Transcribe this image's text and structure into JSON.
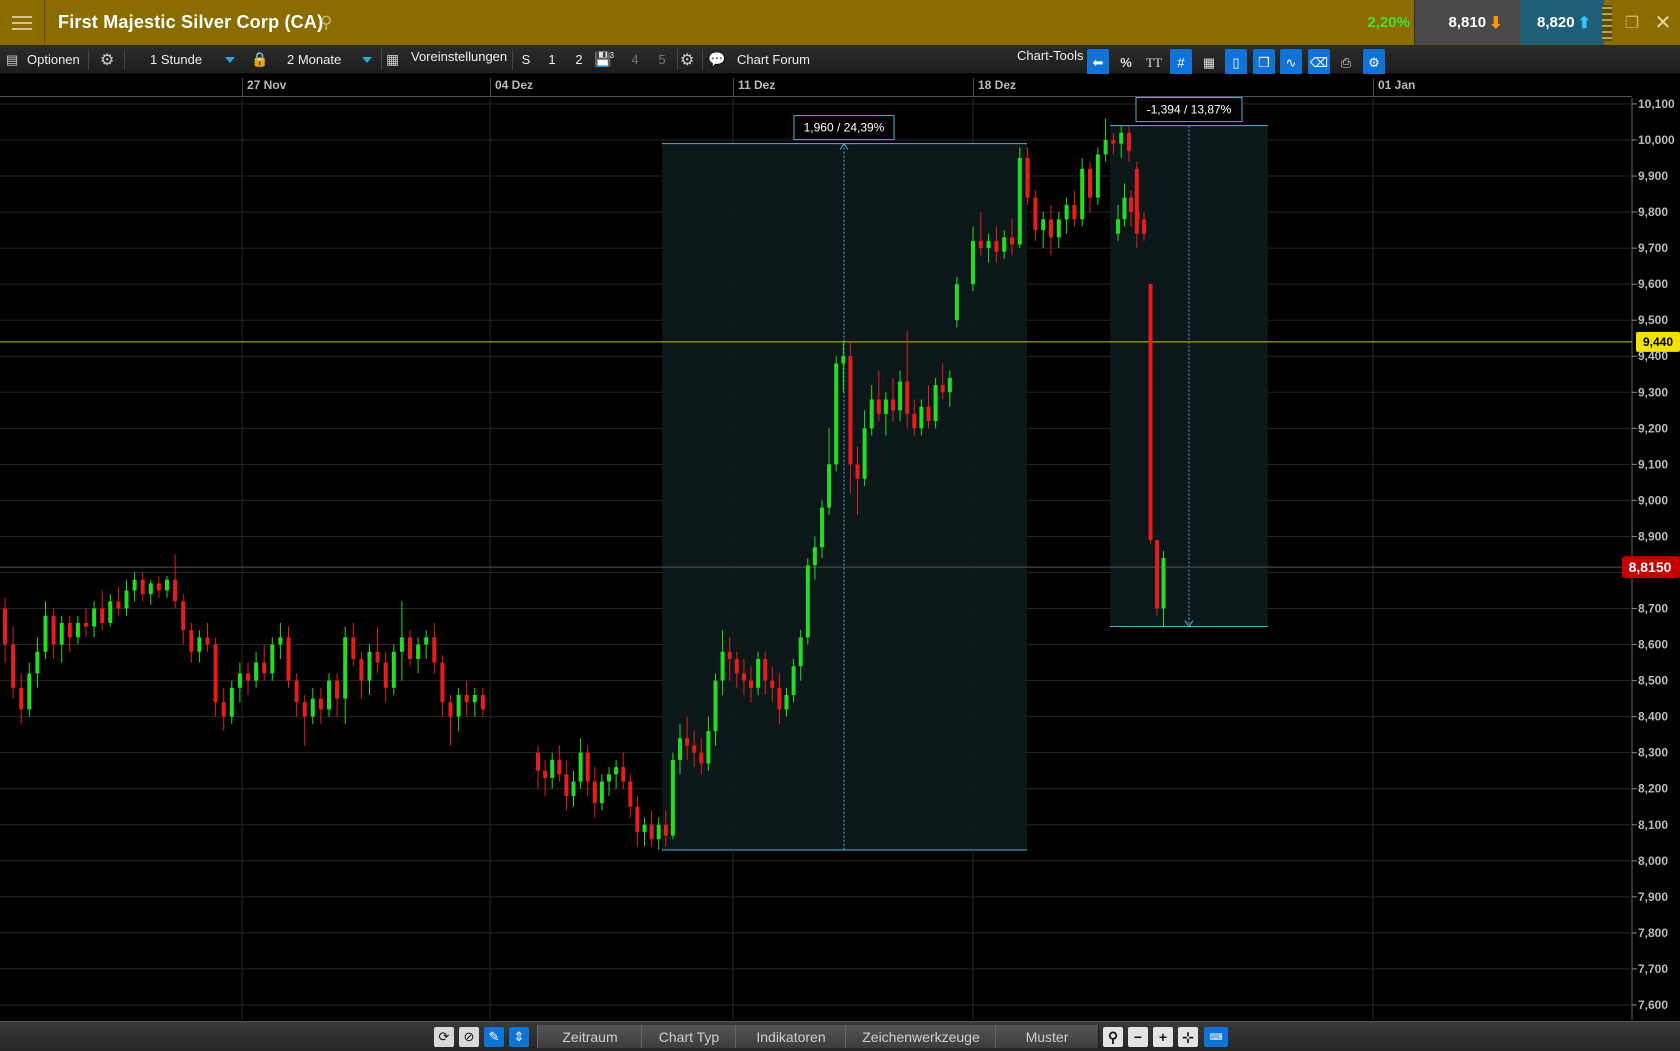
{
  "window": {
    "title": "First Majestic Silver Corp (CA)",
    "change_pct": "2,20%",
    "bid": "8,810",
    "ask": "8,820"
  },
  "toolbar": {
    "options_label": "Optionen",
    "interval": "1 Stunde",
    "range": "2 Monate",
    "presets_label": "Voreinstellungen",
    "preset_s": "S",
    "preset_1": "1",
    "preset_2": "2",
    "preset_3_sup": "3",
    "preset_4": "4",
    "preset_5": "5",
    "forum_label": "Chart Forum",
    "chart_tools_label": "Chart-Tools",
    "percent_icon_label": "%",
    "text_icon_label": "TT"
  },
  "bottombar": {
    "tabs": [
      "Zeitraum",
      "Chart Typ",
      "Indikatoren",
      "Zeichenwerkzeuge",
      "Muster"
    ]
  },
  "colors": {
    "up": "#22dd22",
    "down": "#e81c1c",
    "measure": "#4fb4d4",
    "horizontal_line": "#d4c000",
    "price_tag": "#c40000"
  },
  "chart_data": {
    "type": "candlestick",
    "instrument": "First Majestic Silver Corp (CA)",
    "interval": "1 Stunde",
    "x_labels": [
      "27 Nov",
      "04 Dez",
      "11 Dez",
      "18 Dez",
      "01 Jan"
    ],
    "y_ticks": [
      "7,600",
      "7,700",
      "7,800",
      "7,900",
      "8,000",
      "8,100",
      "8,200",
      "8,300",
      "8,400",
      "8,500",
      "8,600",
      "8,700",
      "8,800",
      "8,900",
      "9,000",
      "9,100",
      "9,200",
      "9,300",
      "9,400",
      "9,500",
      "9,600",
      "9,700",
      "9,800",
      "9,900",
      "10,000",
      "10,100"
    ],
    "ylim": [
      7.55,
      10.12
    ],
    "last_price": 8.815,
    "last_price_label": "8,8150",
    "horizontal_line": {
      "value": 9.44,
      "label": "9,440"
    },
    "measurements": [
      {
        "label": "1,960 / 24,39%",
        "low": 8.03,
        "high": 9.99
      },
      {
        "label": "-1,394 / 13,87%",
        "high": 10.04,
        "low": 8.65
      }
    ],
    "candles": [
      [
        8.7,
        8.73,
        8.55,
        8.6
      ],
      [
        8.6,
        8.65,
        8.45,
        8.48
      ],
      [
        8.48,
        8.52,
        8.38,
        8.42
      ],
      [
        8.42,
        8.55,
        8.4,
        8.52
      ],
      [
        8.52,
        8.62,
        8.48,
        8.58
      ],
      [
        8.58,
        8.72,
        8.56,
        8.68
      ],
      [
        8.68,
        8.7,
        8.56,
        8.6
      ],
      [
        8.6,
        8.68,
        8.55,
        8.66
      ],
      [
        8.66,
        8.68,
        8.58,
        8.62
      ],
      [
        8.62,
        8.68,
        8.6,
        8.66
      ],
      [
        8.66,
        8.7,
        8.62,
        8.65
      ],
      [
        8.65,
        8.72,
        8.62,
        8.7
      ],
      [
        8.7,
        8.75,
        8.64,
        8.66
      ],
      [
        8.66,
        8.74,
        8.65,
        8.72
      ],
      [
        8.72,
        8.76,
        8.68,
        8.7
      ],
      [
        8.7,
        8.78,
        8.68,
        8.75
      ],
      [
        8.75,
        8.8,
        8.72,
        8.78
      ],
      [
        8.78,
        8.8,
        8.72,
        8.74
      ],
      [
        8.74,
        8.78,
        8.71,
        8.77
      ],
      [
        8.77,
        8.79,
        8.73,
        8.75
      ],
      [
        8.75,
        8.79,
        8.73,
        8.78
      ],
      [
        8.78,
        8.85,
        8.7,
        8.72
      ],
      [
        8.72,
        8.74,
        8.6,
        8.64
      ],
      [
        8.64,
        8.66,
        8.55,
        8.58
      ],
      [
        8.58,
        8.64,
        8.55,
        8.62
      ],
      [
        8.62,
        8.66,
        8.58,
        8.6
      ],
      [
        8.6,
        8.62,
        8.4,
        8.44
      ],
      [
        8.44,
        8.48,
        8.36,
        8.4
      ],
      [
        8.4,
        8.5,
        8.38,
        8.48
      ],
      [
        8.48,
        8.55,
        8.44,
        8.52
      ],
      [
        8.52,
        8.55,
        8.46,
        8.5
      ],
      [
        8.5,
        8.58,
        8.48,
        8.55
      ],
      [
        8.55,
        8.6,
        8.5,
        8.52
      ],
      [
        8.52,
        8.62,
        8.5,
        8.6
      ],
      [
        8.6,
        8.66,
        8.56,
        8.62
      ],
      [
        8.62,
        8.65,
        8.48,
        8.5
      ],
      [
        8.5,
        8.52,
        8.4,
        8.44
      ],
      [
        8.44,
        8.46,
        8.32,
        8.4
      ],
      [
        8.4,
        8.48,
        8.38,
        8.45
      ],
      [
        8.45,
        8.48,
        8.38,
        8.42
      ],
      [
        8.42,
        8.52,
        8.4,
        8.5
      ],
      [
        8.5,
        8.52,
        8.4,
        8.45
      ],
      [
        8.45,
        8.65,
        8.38,
        8.62
      ],
      [
        8.62,
        8.66,
        8.54,
        8.56
      ],
      [
        8.56,
        8.58,
        8.45,
        8.5
      ],
      [
        8.5,
        8.6,
        8.46,
        8.58
      ],
      [
        8.58,
        8.65,
        8.52,
        8.55
      ],
      [
        8.55,
        8.58,
        8.44,
        8.48
      ],
      [
        8.48,
        8.6,
        8.46,
        8.58
      ],
      [
        8.58,
        8.72,
        8.5,
        8.62
      ],
      [
        8.62,
        8.64,
        8.54,
        8.56
      ],
      [
        8.56,
        8.62,
        8.52,
        8.6
      ],
      [
        8.6,
        8.64,
        8.56,
        8.62
      ],
      [
        8.62,
        8.66,
        8.52,
        8.55
      ],
      [
        8.55,
        8.57,
        8.4,
        8.44
      ],
      [
        8.44,
        8.46,
        8.32,
        8.4
      ],
      [
        8.4,
        8.48,
        8.36,
        8.46
      ],
      [
        8.46,
        8.5,
        8.4,
        8.44
      ],
      [
        8.44,
        8.48,
        8.4,
        8.46
      ],
      [
        8.46,
        8.48,
        8.4,
        8.42
      ],
      [
        8.3,
        8.32,
        8.2,
        8.25
      ],
      [
        8.25,
        8.28,
        8.18,
        8.23
      ],
      [
        8.23,
        8.3,
        8.2,
        8.28
      ],
      [
        8.28,
        8.32,
        8.22,
        8.24
      ],
      [
        8.24,
        8.28,
        8.14,
        8.18
      ],
      [
        8.18,
        8.25,
        8.15,
        8.22
      ],
      [
        8.22,
        8.34,
        8.2,
        8.3
      ],
      [
        8.3,
        8.32,
        8.18,
        8.22
      ],
      [
        8.22,
        8.26,
        8.12,
        8.16
      ],
      [
        8.16,
        8.24,
        8.14,
        8.22
      ],
      [
        8.22,
        8.26,
        8.18,
        8.24
      ],
      [
        8.24,
        8.28,
        8.2,
        8.26
      ],
      [
        8.26,
        8.3,
        8.2,
        8.22
      ],
      [
        8.22,
        8.24,
        8.12,
        8.15
      ],
      [
        8.15,
        8.18,
        8.04,
        8.08
      ],
      [
        8.08,
        8.12,
        8.04,
        8.1
      ],
      [
        8.1,
        8.14,
        8.04,
        8.06
      ],
      [
        8.06,
        8.12,
        8.03,
        8.1
      ],
      [
        8.1,
        8.14,
        8.04,
        8.07
      ],
      [
        8.07,
        8.3,
        8.06,
        8.28
      ],
      [
        8.28,
        8.38,
        8.24,
        8.34
      ],
      [
        8.34,
        8.4,
        8.28,
        8.32
      ],
      [
        8.32,
        8.36,
        8.26,
        8.3
      ],
      [
        8.3,
        8.34,
        8.24,
        8.27
      ],
      [
        8.27,
        8.4,
        8.25,
        8.36
      ],
      [
        8.36,
        8.52,
        8.32,
        8.5
      ],
      [
        8.5,
        8.64,
        8.46,
        8.58
      ],
      [
        8.58,
        8.62,
        8.5,
        8.56
      ],
      [
        8.56,
        8.58,
        8.48,
        8.52
      ],
      [
        8.52,
        8.56,
        8.46,
        8.5
      ],
      [
        8.5,
        8.54,
        8.44,
        8.48
      ],
      [
        8.48,
        8.58,
        8.46,
        8.56
      ],
      [
        8.56,
        8.58,
        8.46,
        8.5
      ],
      [
        8.5,
        8.54,
        8.44,
        8.48
      ],
      [
        8.48,
        8.52,
        8.38,
        8.42
      ],
      [
        8.42,
        8.48,
        8.4,
        8.46
      ],
      [
        8.46,
        8.56,
        8.44,
        8.54
      ],
      [
        8.54,
        8.64,
        8.5,
        8.62
      ],
      [
        8.62,
        8.84,
        8.6,
        8.82
      ],
      [
        8.82,
        8.9,
        8.78,
        8.87
      ],
      [
        8.87,
        9.0,
        8.84,
        8.98
      ],
      [
        8.98,
        9.2,
        8.96,
        9.1
      ],
      [
        9.1,
        9.4,
        9.08,
        9.38
      ],
      [
        9.38,
        9.44,
        9.3,
        9.4
      ],
      [
        9.4,
        9.44,
        9.02,
        9.1
      ],
      [
        9.1,
        9.15,
        8.96,
        9.06
      ],
      [
        9.06,
        9.25,
        9.04,
        9.2
      ],
      [
        9.2,
        9.32,
        9.18,
        9.28
      ],
      [
        9.28,
        9.36,
        9.22,
        9.24
      ],
      [
        9.24,
        9.3,
        9.18,
        9.28
      ],
      [
        9.28,
        9.34,
        9.22,
        9.25
      ],
      [
        9.25,
        9.36,
        9.22,
        9.33
      ],
      [
        9.33,
        9.47,
        9.2,
        9.24
      ],
      [
        9.24,
        9.28,
        9.18,
        9.2
      ],
      [
        9.2,
        9.28,
        9.18,
        9.26
      ],
      [
        9.26,
        9.32,
        9.2,
        9.22
      ],
      [
        9.22,
        9.34,
        9.2,
        9.32
      ],
      [
        9.32,
        9.38,
        9.28,
        9.3
      ],
      [
        9.3,
        9.36,
        9.26,
        9.34
      ],
      [
        9.5,
        9.62,
        9.48,
        9.6
      ],
      [
        9.6,
        9.76,
        9.58,
        9.72
      ],
      [
        9.72,
        9.8,
        9.68,
        9.7
      ],
      [
        9.7,
        9.74,
        9.66,
        9.72
      ],
      [
        9.72,
        9.76,
        9.66,
        9.69
      ],
      [
        9.69,
        9.75,
        9.67,
        9.73
      ],
      [
        9.73,
        9.78,
        9.68,
        9.71
      ],
      [
        9.71,
        9.98,
        9.7,
        9.95
      ],
      [
        9.95,
        9.98,
        9.82,
        9.84
      ],
      [
        9.84,
        9.86,
        9.72,
        9.75
      ],
      [
        9.75,
        9.8,
        9.7,
        9.78
      ],
      [
        9.78,
        9.82,
        9.68,
        9.73
      ],
      [
        9.73,
        9.8,
        9.7,
        9.78
      ],
      [
        9.78,
        9.84,
        9.74,
        9.82
      ],
      [
        9.82,
        9.86,
        9.76,
        9.78
      ],
      [
        9.78,
        9.95,
        9.76,
        9.92
      ],
      [
        9.92,
        9.94,
        9.8,
        9.84
      ],
      [
        9.84,
        9.98,
        9.82,
        9.96
      ],
      [
        9.96,
        10.06,
        9.94,
        10.0
      ],
      [
        10.0,
        10.02,
        9.96,
        9.99
      ],
      [
        9.99,
        10.04,
        9.95,
        10.02
      ],
      [
        10.02,
        10.04,
        9.94,
        9.97
      ],
      [
        9.92,
        9.94,
        9.7,
        9.74
      ],
      [
        9.74,
        9.82,
        9.72,
        9.78
      ],
      [
        9.78,
        9.88,
        9.76,
        9.84
      ],
      [
        9.84,
        9.86,
        9.76,
        9.8
      ],
      [
        9.8,
        9.82,
        9.76,
        9.78
      ],
      [
        9.78,
        9.8,
        9.72,
        9.74
      ],
      [
        9.6,
        9.6,
        8.88,
        8.89
      ],
      [
        8.89,
        8.89,
        8.68,
        8.7
      ],
      [
        8.7,
        8.86,
        8.65,
        8.84
      ]
    ]
  }
}
